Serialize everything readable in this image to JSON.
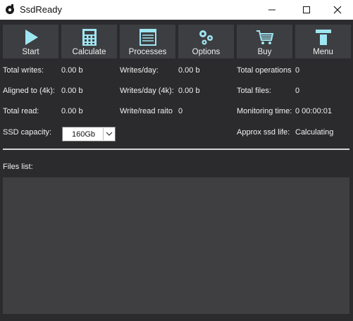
{
  "window": {
    "title": "SsdReady",
    "controls": {
      "minimize": "minimize-icon",
      "maximize": "maximize-icon",
      "close": "close-icon"
    }
  },
  "toolbar": {
    "start": "Start",
    "calculate": "Calculate",
    "processes": "Processes",
    "options": "Options",
    "buy": "Buy",
    "menu": "Menu"
  },
  "stats": {
    "total_writes_label": "Total writes:",
    "total_writes_value": "0.00 b",
    "aligned_label": "Aligned to (4k):",
    "aligned_value": "0.00 b",
    "total_read_label": "Total read:",
    "total_read_value": "0.00 b",
    "writes_day_label": "Writes/day:",
    "writes_day_value": "0.00 b",
    "writes_day_4k_label": "Writes/day (4k):",
    "writes_day_4k_value": "0.00 b",
    "rw_ratio_label": "Write/read raito",
    "rw_ratio_value": "0",
    "total_ops_label": "Total operations",
    "total_ops_value": "0",
    "total_files_label": "Total files:",
    "total_files_value": "0",
    "monitoring_label": "Monitoring time:",
    "monitoring_value": "0 00:00:01",
    "ssd_capacity_label": "SSD capacity:",
    "ssd_capacity_value": "160Gb",
    "ssd_life_label": "Approx ssd life:",
    "ssd_life_value": "Calculating"
  },
  "files": {
    "label": "Files list:"
  },
  "colors": {
    "background": "#2b2b2d",
    "button": "#3d3e41",
    "icon_accent": "#9ee6f2",
    "text": "#f0f0f0",
    "list_bg": "#3f3f41"
  }
}
